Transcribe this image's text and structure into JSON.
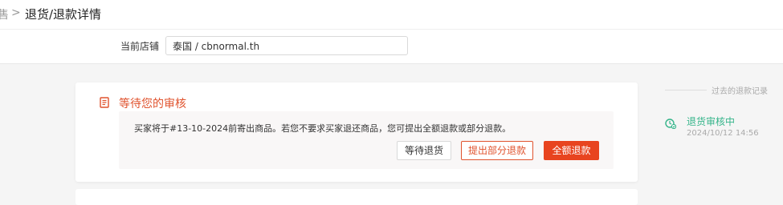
{
  "header": {
    "breadcrumb_prev": "售",
    "separator": ">",
    "title": "退货/退款详情"
  },
  "store": {
    "label": "当前店铺",
    "value": "泰国 / cbnormal.th"
  },
  "status_card": {
    "icon": "document-icon",
    "title": "等待您的审核",
    "message": "买家将于#13-10-2024前寄出商品。若您不要求买家退还商品，您可提出全额退款或部分退款。",
    "buttons": {
      "wait_return": "等待退货",
      "partial_refund": "提出部分退款",
      "full_refund": "全额退款"
    }
  },
  "history": {
    "title": "过去的退款记录",
    "items": [
      {
        "icon": "clock-check-icon",
        "status": "退货审核中",
        "time": "2024/10/12 14:56"
      }
    ]
  },
  "colors": {
    "accent": "#e0532e",
    "primary_button": "#e8441f",
    "success": "#35b48a"
  }
}
